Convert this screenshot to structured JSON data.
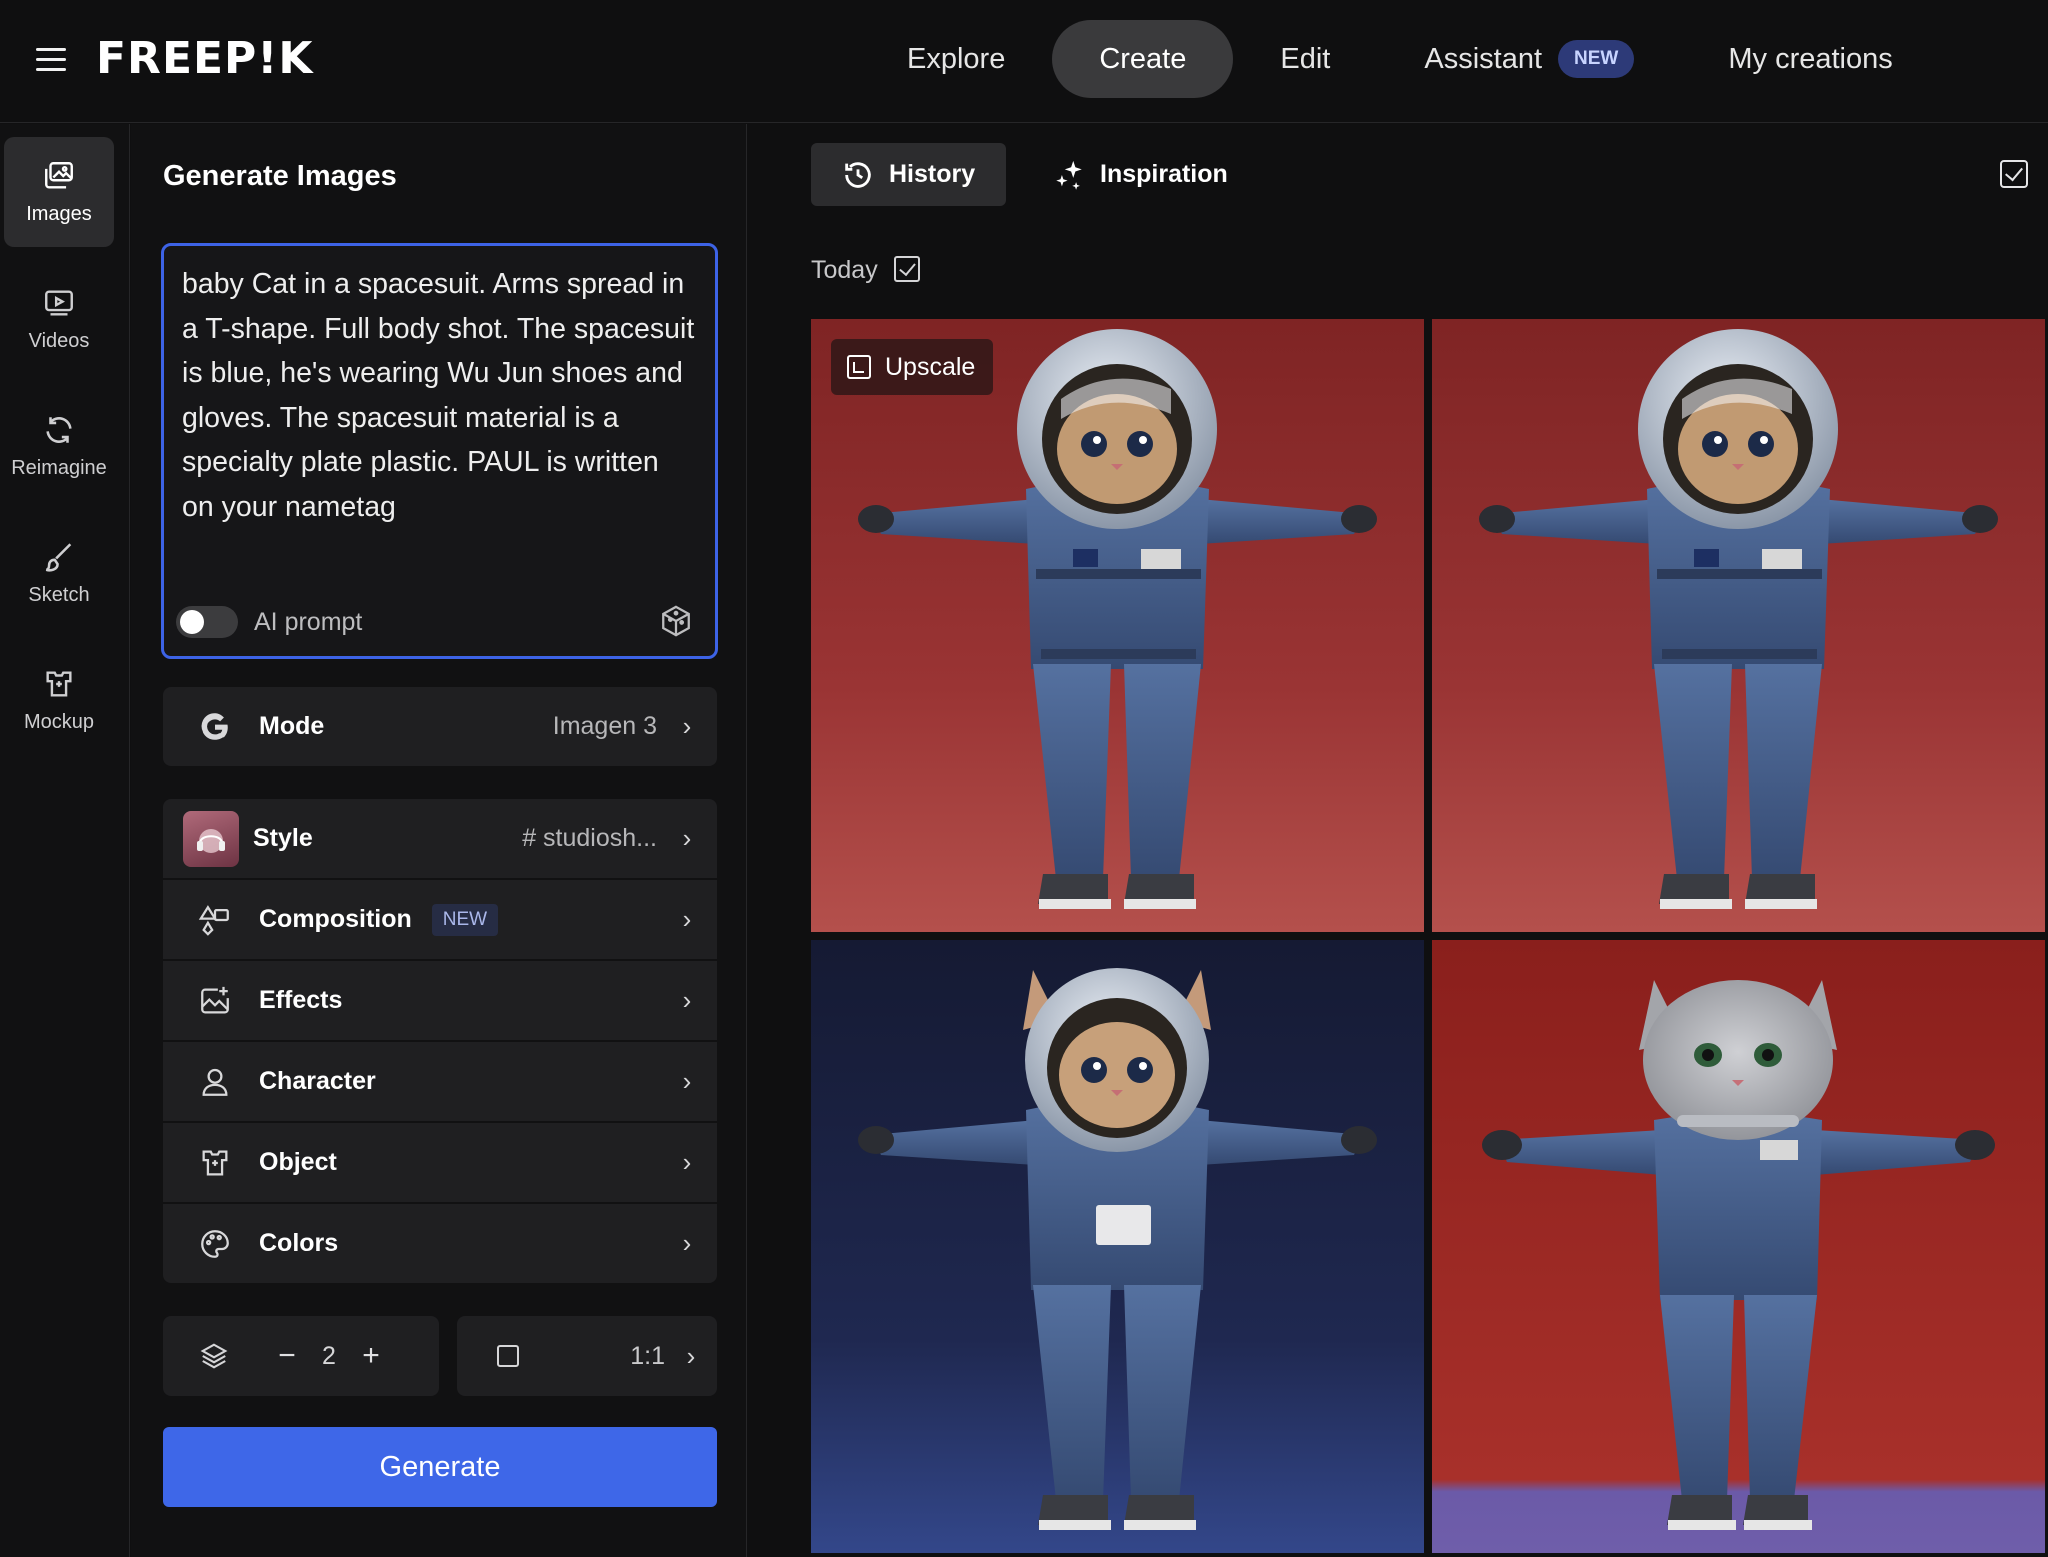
{
  "header": {
    "logo": "FREEP!K",
    "nav": [
      {
        "label": "Explore",
        "active": false
      },
      {
        "label": "Create",
        "active": true
      },
      {
        "label": "Edit",
        "active": false
      },
      {
        "label": "Assistant",
        "badge": "NEW",
        "active": false
      },
      {
        "label": "My creations",
        "active": false
      }
    ]
  },
  "rail": {
    "items": [
      {
        "label": "Images",
        "icon": "images-icon",
        "active": true
      },
      {
        "label": "Videos",
        "icon": "video-icon",
        "active": false
      },
      {
        "label": "Reimagine",
        "icon": "refresh-icon",
        "active": false
      },
      {
        "label": "Sketch",
        "icon": "brush-icon",
        "active": false
      },
      {
        "label": "Mockup",
        "icon": "mockup-icon",
        "active": false
      }
    ]
  },
  "panel": {
    "title": "Generate Images",
    "prompt": "baby Cat in a spacesuit. Arms spread in a T-shape. Full body shot. The spacesuit is blue, he's wearing Wu Jun shoes and gloves. The spacesuit material is a specialty plate plastic. PAUL is written on your nametag",
    "ai_prompt_label": "AI prompt",
    "ai_prompt_enabled": false,
    "mode": {
      "label": "Mode",
      "value": "Imagen 3",
      "icon": "google-g-icon"
    },
    "settings": [
      {
        "label": "Style",
        "value": "# studiosh...",
        "icon": "style-thumbnail"
      },
      {
        "label": "Composition",
        "badge": "NEW",
        "icon": "shapes-icon"
      },
      {
        "label": "Effects",
        "icon": "image-sparkle-icon"
      },
      {
        "label": "Character",
        "icon": "person-icon"
      },
      {
        "label": "Object",
        "icon": "object-icon"
      },
      {
        "label": "Colors",
        "icon": "palette-icon"
      }
    ],
    "image_count": "2",
    "aspect_ratio": "1:1",
    "generate_label": "Generate"
  },
  "results": {
    "tabs": [
      {
        "label": "History",
        "icon": "history-icon",
        "active": true
      },
      {
        "label": "Inspiration",
        "icon": "sparkles-icon",
        "active": false
      }
    ],
    "group_label": "Today",
    "upscale_label": "Upscale",
    "images": [
      {
        "alt": "astronaut kitten",
        "background": "#8e2a2a"
      },
      {
        "alt": "astronaut kitten",
        "background": "#8e2a2a"
      },
      {
        "alt": "astronaut kitten",
        "background": "#1b2142"
      },
      {
        "alt": "astronaut kitten",
        "background": "#8f231f"
      }
    ]
  },
  "colors": {
    "accent": "#3e67e8",
    "badge_bg": "#2d3a78",
    "panel_bg": "#111112",
    "row_bg": "#1f1f21"
  }
}
